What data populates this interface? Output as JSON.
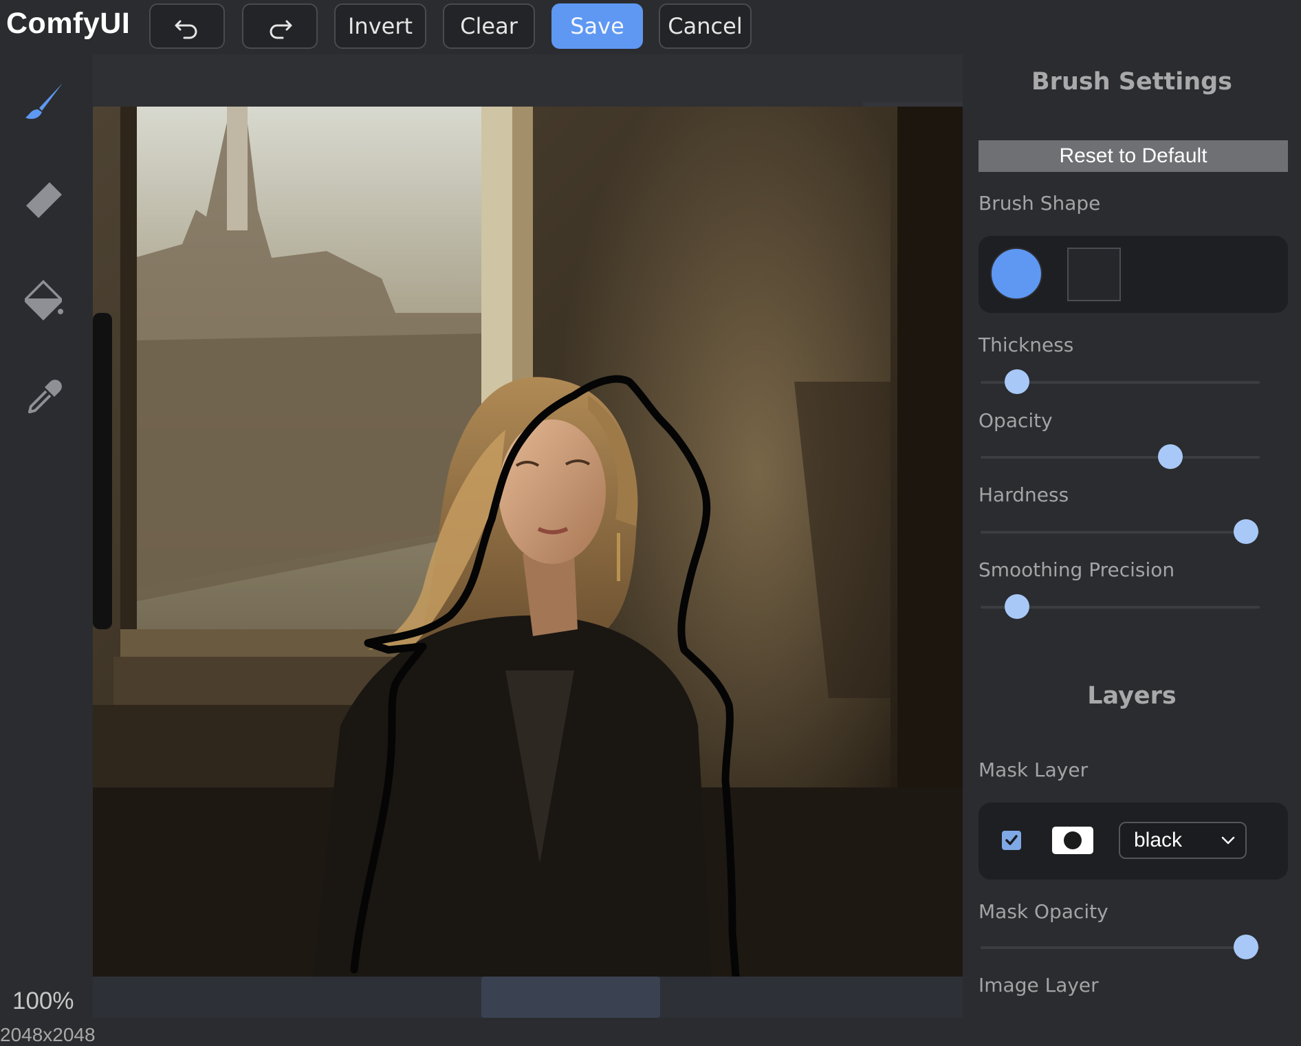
{
  "app": {
    "title": "ComfyUI"
  },
  "toolbar": {
    "undo_icon": "undo-arrow-icon",
    "redo_icon": "redo-arrow-icon",
    "invert_label": "Invert",
    "clear_label": "Clear",
    "save_label": "Save",
    "cancel_label": "Cancel",
    "accent_color": "#5e98f2"
  },
  "tools": [
    {
      "name": "brush",
      "icon": "paintbrush-icon",
      "active": true
    },
    {
      "name": "eraser",
      "icon": "eraser-icon",
      "active": false
    },
    {
      "name": "paint-bucket",
      "icon": "paint-bucket-icon",
      "active": false
    },
    {
      "name": "color-picker",
      "icon": "eyedropper-icon",
      "active": false
    }
  ],
  "canvas": {
    "zoom": "100%",
    "dimensions": "2048x2048",
    "image_description": "photo of a woman seated by a sunlit window with a black mask outline drawn around her"
  },
  "brush_settings": {
    "title": "Brush Settings",
    "reset_label": "Reset to Default",
    "brush_shape_label": "Brush Shape",
    "shapes": [
      "circle",
      "square"
    ],
    "selected_shape": "circle",
    "thickness": {
      "label": "Thickness",
      "value": 0.13
    },
    "opacity": {
      "label": "Opacity",
      "value": 0.68
    },
    "hardness": {
      "label": "Hardness",
      "value": 0.95
    },
    "smoothing": {
      "label": "Smoothing Precision",
      "value": 0.13
    }
  },
  "layers": {
    "title": "Layers",
    "mask_layer_label": "Mask Layer",
    "mask_layer_visible": true,
    "mask_color": "black",
    "mask_opacity": {
      "label": "Mask Opacity",
      "value": 0.95
    },
    "image_layer_label": "Image Layer"
  }
}
